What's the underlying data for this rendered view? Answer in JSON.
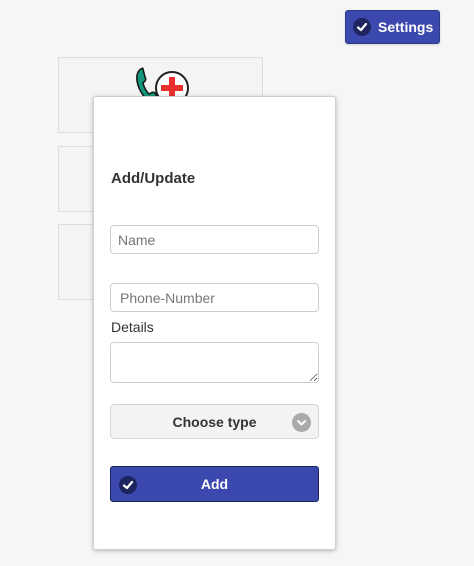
{
  "header": {
    "settings_label": "Settings",
    "settings_icon": "check-circle-icon"
  },
  "background": {
    "logo_icon": "phone-plus-icon"
  },
  "form": {
    "title": "Add/Update",
    "name_placeholder": "Name",
    "name_value": "",
    "phone_placeholder": "Phone-Number",
    "phone_value": "",
    "details_label": "Details",
    "details_value": "",
    "type_select_label": "Choose type",
    "add_label": "Add"
  },
  "colors": {
    "primary_button": "#3b48ad",
    "icon_dark": "#1f2560",
    "phone_icon": "#15957a",
    "plus_icon": "#e8312f"
  }
}
